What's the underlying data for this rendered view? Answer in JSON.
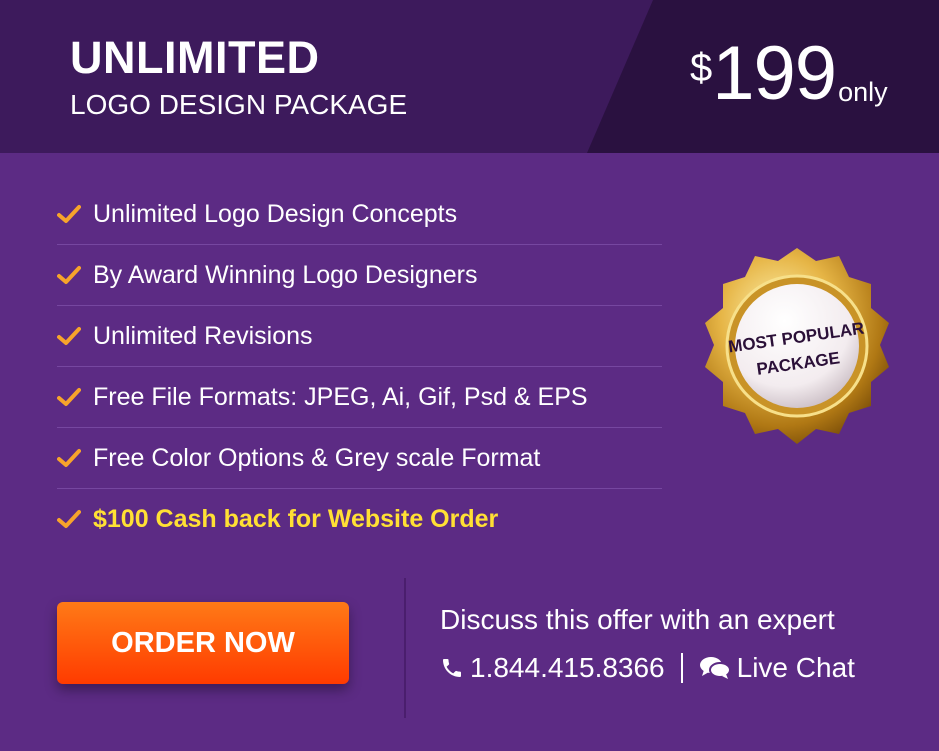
{
  "header": {
    "title": "UNLIMITED",
    "subtitle": "LOGO DESIGN PACKAGE",
    "price_currency": "$",
    "price_amount": "199",
    "price_suffix": "only"
  },
  "features": [
    {
      "text": "Unlimited Logo Design Concepts"
    },
    {
      "text": "By Award Winning Logo Designers"
    },
    {
      "text": "Unlimited Revisions"
    },
    {
      "text": "Free File Formats: JPEG, Ai, Gif, Psd & EPS"
    },
    {
      "text": "Free Color Options & Grey scale Format"
    },
    {
      "text": "$100 Cash back for Website Order"
    }
  ],
  "badge": {
    "line1": "MOST POPULAR",
    "line2": "PACKAGE",
    "icon": "seal-badge-icon"
  },
  "cta": {
    "order_label": "ORDER NOW",
    "discuss_text": "Discuss this offer with an expert",
    "phone": "1.844.415.8366",
    "chat_label": "Live Chat"
  },
  "colors": {
    "background": "#5c2b84",
    "header": "#3d1a5c",
    "header_dark": "#2a1140",
    "check": "#f7a42b",
    "highlight": "#ffe034",
    "button": "#ff5a0a"
  }
}
